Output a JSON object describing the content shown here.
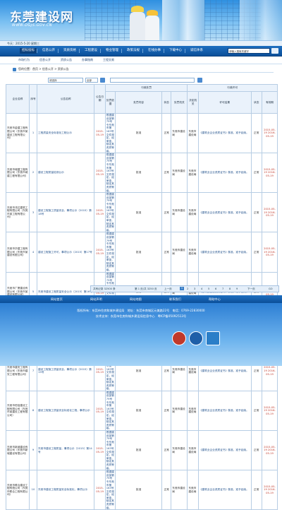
{
  "header": {
    "logo_text": "东莞建设网",
    "logo_url": "WWW.DGJS.GOV.CN"
  },
  "infobar": {
    "text": "今天：2015-5-20 星期三"
  },
  "nav": {
    "items": [
      "招标投标",
      "信息公开",
      "资质资格",
      "工程建设",
      "物业管理",
      "政策法规",
      "在线办事",
      "下载中心",
      "诚信体系"
    ],
    "search_placeholder": "请输入搜索关键字"
  },
  "subnav": {
    "items": [
      "市场行为",
      "信息公开",
      "资质公告",
      "办事指南",
      "工程交易"
    ]
  },
  "breadcrumb": {
    "text": "您的位置：首页 > 信息公开 > 资质公告"
  },
  "toolbar": {
    "filter1": "请选择",
    "filter2": "全部"
  },
  "table": {
    "headers": {
      "name": "企业名称",
      "idx": "序号",
      "case": "公告名称",
      "date": "公告日期",
      "group_main": "行政处罚",
      "basis": "处罚依据",
      "content": "处罚内容",
      "status": "状态",
      "org": "处罚机关",
      "group_right": "行政许可",
      "authority": "决定机关",
      "result": "许可结果",
      "time": "有效期"
    },
    "rows": [
      {
        "name": "东莞市金建工程有限公司（东莞市某建设工程有限公司）",
        "idx": "1",
        "case": "工程质量安全标准化工程公示",
        "date": "2015-05-19",
        "basis": "根据建设部第79号令东莞市第163号文件规定，经审查，核定其资质等级。",
        "content": "批准",
        "org": "东莞市建设局",
        "status": "正常",
        "authority": "东莞市建设局",
        "result": "《建筑业企业资质证书》核准，准予延续。",
        "time": "2015-05-19 2016-05-19"
      },
      {
        "name": "东莞市城建工程有限公司（东莞市城建工程有限公司）",
        "idx": "2",
        "case": "建设工程质量检测公示",
        "date": "2015-05-19",
        "basis": "根据建设部第79号令东莞市第163号文件规定，经审查，核定其资质等级。",
        "content": "批准",
        "org": "东莞市建设局",
        "status": "正常",
        "authority": "东莞市建设局",
        "result": "《建筑业企业资质证书》核准，准予延续。",
        "time": "2015-05-19 2016-05-19"
      },
      {
        "name": "东莞市鸿达建筑工程有限公司（东莞市某工程有限公司）",
        "idx": "3",
        "case": "建设工程施工质量安全，事项公示（2015）第18号",
        "date": "2015-05-19",
        "basis": "根据建设部第79号令东莞市第163号文件规定，经审查，核定其资质等级。",
        "content": "批准",
        "org": "东莞市建设局",
        "status": "正常",
        "authority": "东莞市建设局",
        "result": "《建筑业企业资质证书》核准，准予延续。",
        "time": "2015-05-19 2016-05-19"
      },
      {
        "name": "东莞市华建工程有限公司（东莞市某建设有限公司）",
        "idx": "4",
        "case": "建设工程施工许可，事项公示（2015）第17号",
        "date": "2015-05-19",
        "basis": "根据建设部第79号令东莞市第163号文件规定，经审查，核定其资质等级。",
        "content": "批准",
        "org": "东莞市建设局",
        "status": "正常",
        "authority": "东莞市建设局",
        "result": "《建筑业企业资质证书》核准，准予延续。",
        "time": "2015-05-19 2016-05-19"
      },
      {
        "name": "东莞市广厦建设有限公司（东莞市某建设有限公司）",
        "idx": "5",
        "case": "东莞市建设工程质量安全公示（2015）第16号",
        "date": "2015-05-19",
        "basis": "根据建设部第79号令东莞市第163号文件规定，经审查，核定其资质等级。",
        "content": "批准",
        "org": "东莞市建设局",
        "status": "正常",
        "authority": "东莞市建设局",
        "result": "《建筑业企业资质证书》核准，准予延续。",
        "time": "2015-05-19 2016-05-19"
      },
      {
        "name": "东莞市宏远工程有限公司（东莞市宏远工程有限公司）",
        "idx": "6",
        "case": "东莞市建设工程安全生产事项公示",
        "date": "2015-05-19",
        "basis": "根据建设部第79号令东莞市第163号文件规定，经审查，核定其资质等级。",
        "content": "批准",
        "org": "东莞市建设局",
        "status": "正常",
        "authority": "东莞市建设局",
        "result": "《建筑业企业资质证书》核准，准予延续。",
        "time": "2015-05-19 2016-05-19"
      },
      {
        "name": "东莞市建安工程有限公司（东莞市建安工程有限公司）",
        "idx": "7",
        "case": "建设工程施工质量安全，事项公示（2015）第15号",
        "date": "2015-05-19",
        "basis": "根据建设部第79号令东莞市第163号文件规定，经审查，核定其资质等级。",
        "content": "批准",
        "org": "东莞市建设局",
        "status": "正常",
        "authority": "东莞市建设局",
        "result": "《建筑业企业资质证书》核准，准予延续。",
        "time": "2015-05-19 2016-05-19"
      },
      {
        "name": "东莞市恒信建设工程有限公司（东莞市某建设工程有限公司）",
        "idx": "8",
        "case": "建设工程施工质量安全标准化工程，事项公示",
        "date": "2015-05-19",
        "basis": "根据建设部第79号令东莞市第163号文件规定，经审查，核定其资质等级。",
        "content": "批准",
        "org": "东莞市建设局",
        "status": "正常",
        "authority": "东莞市建设局",
        "result": "《建筑业企业资质证书》核准，准予延续。",
        "time": "2015-05-19 2016-05-19"
      },
      {
        "name": "东莞市新城建设有限公司（东莞市新城建设有限公司）",
        "idx": "9",
        "case": "东莞市建设工程质量，事项公示（2015）第14号",
        "date": "2015-05-19",
        "basis": "根据建设部第79号令东莞市第163号文件规定，经审查，核定其资质等级。",
        "content": "批准",
        "org": "东莞市建设局",
        "status": "正常",
        "authority": "东莞市建设局",
        "result": "《建筑业企业资质证书》核准，准予延续。",
        "time": "2015-05-19 2016-05-19"
      },
      {
        "name": "东莞市联合建设工程有限公司（东莞市联合工程有限公司）",
        "idx": "10",
        "case": "东莞市建设工程质量安全标准化，事项公示",
        "date": "2015-05-19",
        "basis": "根据建设部第79号令东莞市第163号文件规定，经审查，核定其资质等级。",
        "content": "批准",
        "org": "东莞市建设局",
        "status": "正常",
        "authority": "东莞市建设局",
        "result": "《建筑业企业资质证书》核准，准予延续。",
        "time": "2015-05-19 2016-05-19"
      }
    ]
  },
  "pager": {
    "total": "共有记录 32500 条",
    "page": "第 1 页/共 3250 页",
    "pages": [
      "1",
      "2",
      "3",
      "4",
      "5",
      "6",
      "7",
      "8",
      "9"
    ],
    "prev": "上一页",
    "next": "下一页",
    "go": "GO"
  },
  "footer_nav": {
    "items": [
      "网站首页",
      "网站声明",
      "网站地图",
      "联系我们",
      "帮助中心"
    ]
  },
  "footer": {
    "line1": "版权所有：东莞市住房和城乡建设局　地址：东莞市南城区元美路22号　电话：0769-22830000",
    "line2": "技术支持：东莞市住房和城乡建设局信息中心　粤ICP备05092513号"
  }
}
